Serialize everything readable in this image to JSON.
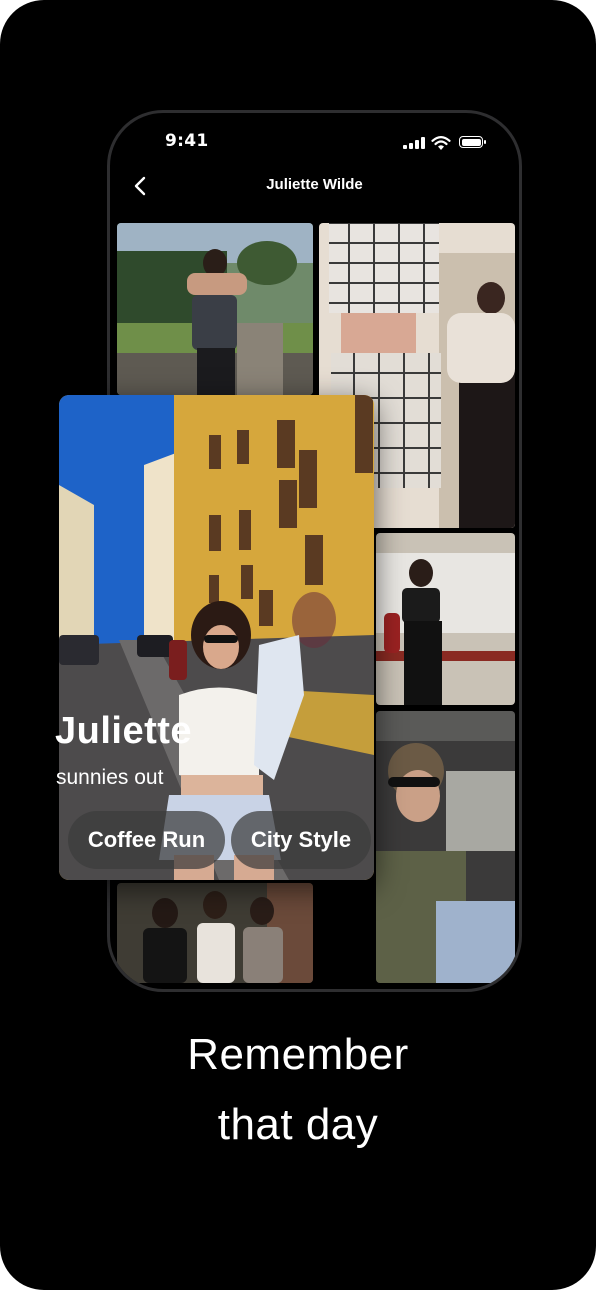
{
  "status_bar": {
    "time": "9:41"
  },
  "nav": {
    "title": "Juliette Wilde"
  },
  "feature": {
    "name": "Juliette",
    "caption": "sunnies out",
    "tags": [
      "Coffee Run",
      "City Style"
    ]
  },
  "headline": {
    "line1": "Remember",
    "line2": "that day"
  },
  "colors": {
    "background": "#000000",
    "text": "#ffffff",
    "chip": "#3c3c3c",
    "wall": "#d6a73c",
    "sky": "#1e63c8"
  },
  "icons": [
    "back-chevron-icon",
    "signal-icon",
    "wifi-icon",
    "battery-icon"
  ]
}
